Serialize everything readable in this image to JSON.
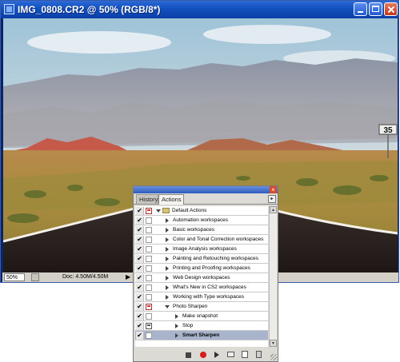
{
  "document": {
    "title": "IMG_0808.CR2 @ 50% (RGB/8*)",
    "zoom": "50%",
    "doc_size": "Doc: 4.50M/4.50M",
    "road_sign": "35"
  },
  "palette": {
    "tabs": [
      {
        "label": "History",
        "active": false
      },
      {
        "label": "Actions",
        "active": true
      }
    ],
    "rows": [
      {
        "label": "Default Actions",
        "level": 0,
        "expanded": true,
        "type": "set",
        "dialog": "red"
      },
      {
        "label": "Automation workspaces",
        "level": 1,
        "type": "action"
      },
      {
        "label": "Basic workspaces",
        "level": 1,
        "type": "action"
      },
      {
        "label": "Color and Tonal Correction workspaces",
        "level": 1,
        "type": "action"
      },
      {
        "label": "Image Analysis workspaces",
        "level": 1,
        "type": "action"
      },
      {
        "label": "Painting and Retouching workspaces",
        "level": 1,
        "type": "action"
      },
      {
        "label": "Printing and Proofing workspaces",
        "level": 1,
        "type": "action"
      },
      {
        "label": "Web Design workspaces",
        "level": 1,
        "type": "action"
      },
      {
        "label": "What's New in CS2 workspaces",
        "level": 1,
        "type": "action"
      },
      {
        "label": "Working with Type workspaces",
        "level": 1,
        "type": "action"
      },
      {
        "label": "Photo Sharpen",
        "level": 1,
        "expanded": true,
        "type": "action",
        "dialog": "red"
      },
      {
        "label": "Make snapshot",
        "level": 2,
        "type": "step"
      },
      {
        "label": "Stop",
        "level": 2,
        "type": "step",
        "dialog": "dark"
      },
      {
        "label": "Smart Sharpen",
        "level": 2,
        "type": "step",
        "selected": true
      }
    ]
  },
  "colors": {
    "titlebar": "#1452c0",
    "selected_row": "#a8b4cc",
    "record_button": "#d61c1c"
  },
  "icons": [
    "document-icon",
    "minimize-icon",
    "maximize-icon",
    "close-icon",
    "checkmark-icon",
    "folder-icon",
    "stop-icon",
    "record-icon",
    "play-icon",
    "new-set-icon",
    "new-action-icon",
    "trash-icon",
    "palette-menu-icon"
  ]
}
